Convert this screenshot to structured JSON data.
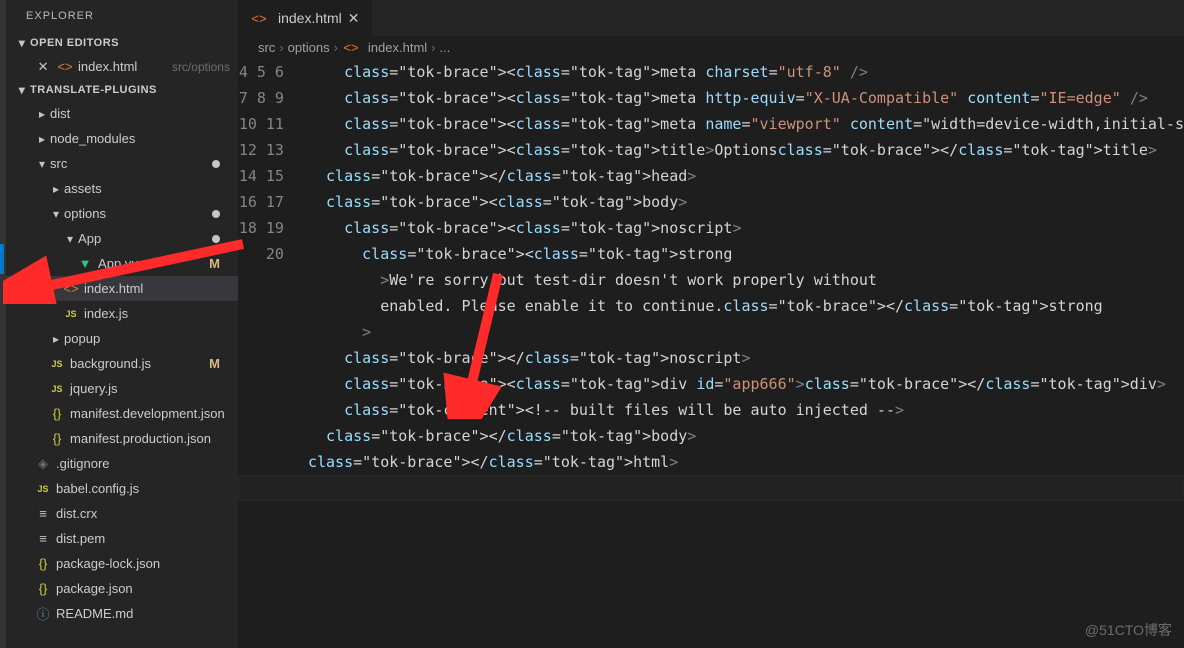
{
  "explorer": {
    "title": "EXPLORER"
  },
  "sections": {
    "openEditors": "OPEN EDITORS",
    "project": "TRANSLATE-PLUGINS"
  },
  "openEditors": [
    {
      "name": "index.html",
      "path": "src/options"
    }
  ],
  "tree": [
    {
      "d": 1,
      "t": "folder",
      "name": "dist",
      "open": false
    },
    {
      "d": 1,
      "t": "folder",
      "name": "node_modules",
      "open": false
    },
    {
      "d": 1,
      "t": "folder",
      "name": "src",
      "open": true,
      "dot": true
    },
    {
      "d": 2,
      "t": "folder",
      "name": "assets",
      "open": false
    },
    {
      "d": 2,
      "t": "folder",
      "name": "options",
      "open": true,
      "dot": true
    },
    {
      "d": 3,
      "t": "folder",
      "name": "App",
      "open": true,
      "dot": true
    },
    {
      "d": 4,
      "t": "vue",
      "name": "App.vue",
      "mod": "M"
    },
    {
      "d": 3,
      "t": "html",
      "name": "index.html",
      "active": true
    },
    {
      "d": 3,
      "t": "js",
      "name": "index.js"
    },
    {
      "d": 2,
      "t": "folder",
      "name": "popup",
      "open": false
    },
    {
      "d": 2,
      "t": "js",
      "name": "background.js",
      "mod": "M"
    },
    {
      "d": 2,
      "t": "js",
      "name": "jquery.js"
    },
    {
      "d": 2,
      "t": "json",
      "name": "manifest.development.json"
    },
    {
      "d": 2,
      "t": "json",
      "name": "manifest.production.json"
    },
    {
      "d": 1,
      "t": "git",
      "name": ".gitignore"
    },
    {
      "d": 1,
      "t": "js",
      "name": "babel.config.js"
    },
    {
      "d": 1,
      "t": "text",
      "name": "dist.crx"
    },
    {
      "d": 1,
      "t": "text",
      "name": "dist.pem"
    },
    {
      "d": 1,
      "t": "json",
      "name": "package-lock.json"
    },
    {
      "d": 1,
      "t": "json",
      "name": "package.json"
    },
    {
      "d": 1,
      "t": "info",
      "name": "README.md"
    }
  ],
  "editorTab": {
    "name": "index.html"
  },
  "breadcrumb": [
    "src",
    "options",
    "index.html",
    "..."
  ],
  "code": {
    "start": 4,
    "lines": [
      "    <meta charset=\"utf-8\" />",
      "    <meta http-equiv=\"X-UA-Compatible\" content=\"IE=edge\" />",
      "    <meta name=\"viewport\" content=\"width=device-width,initial-s",
      "    <title>Options</title>",
      "  </head>",
      "  <body>",
      "    <noscript>",
      "      <strong",
      "        >We're sorry but test-dir doesn't work properly without",
      "        enabled. Please enable it to continue.</strong",
      "      >",
      "    </noscript>",
      "    <div id=\"app666\"></div>",
      "    <!-- built files will be auto injected -->",
      "  </body>",
      "</html>",
      ""
    ]
  },
  "watermark": "@51CTO博客"
}
